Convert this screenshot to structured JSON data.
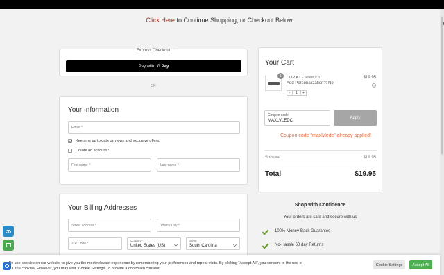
{
  "notice": {
    "link": "Click Here",
    "rest": " to Continue Shopping, or Checkout Below."
  },
  "express": {
    "label": "Express Checkout",
    "gpay_prefix": "Pay with",
    "gpay_brand": "G Pay",
    "or": "OR"
  },
  "info": {
    "title": "Your Information",
    "email_placeholder": "Email *",
    "newsletter_label": "Keep me up to date on news and exclusive offers.",
    "account_label": "Create an account?",
    "first_name_placeholder": "First name *",
    "last_name_placeholder": "Last name *"
  },
  "billing": {
    "title": "Your Billing Addresses",
    "street_placeholder": "Street address *",
    "town_placeholder": "Town / City *",
    "zip_placeholder": "ZIP Code *",
    "country_label": "Country *",
    "country_value": "United States (US)",
    "state_label": "State *",
    "state_value": "South Carolina"
  },
  "cart": {
    "title": "Your Cart",
    "badge": "1",
    "item_name": "CLIP KT - Silver × 1",
    "item_option": "Add Personalization?: No",
    "item_price": "$19.95",
    "qty_minus": "-",
    "qty_value": "1",
    "qty_plus": "+",
    "remove": "×",
    "coupon_label": "Coupon code",
    "coupon_value": "MAXLVLEDC",
    "apply": "Apply",
    "applied_msg": "Coupon code \"maxlvledc\" already applied!",
    "subtotal_label": "Subtotal",
    "subtotal_value": "$19.95",
    "total_label": "Total",
    "total_value": "$19.95"
  },
  "confidence": {
    "title": "Shop with Confidence",
    "subtitle": "Your orders are safe and secure with us",
    "perks": [
      "100% Money-Back Guarantee",
      "No-Hassle 60 day Returns"
    ]
  },
  "cookie": {
    "text": "We use cookies on our website to give you the most relevant experience by remembering your preferences and repeat visits. By clicking \"Accept All\", you consent to the use of ALL the cookies. However, you may visit \"Cookie Settings\" to provide a controlled consent.",
    "settings": "Cookie Settings",
    "accept": "Accept All"
  },
  "colors": {
    "link": "#9b2a1c",
    "applied": "#e06a3d",
    "accent_green": "#4caf50",
    "tick": "#6a9a2c"
  }
}
